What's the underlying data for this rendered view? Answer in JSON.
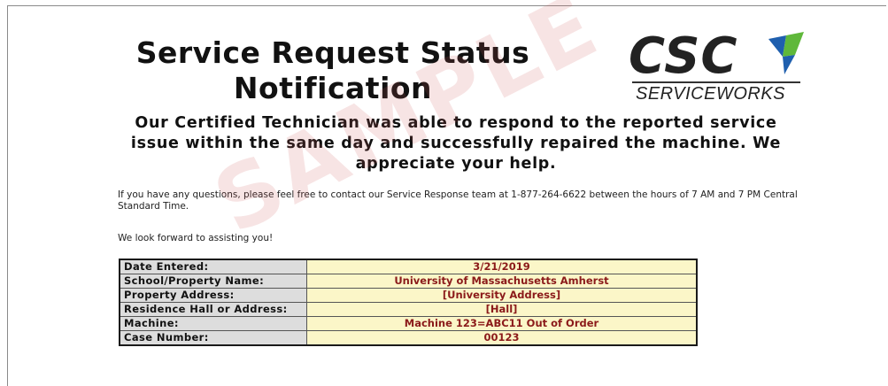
{
  "document": {
    "title_line1": "Service Request Status",
    "title_line2": "Notification",
    "intro": "Our Certified Technician was able to respond to the reported service issue within the same day and successfully repaired the machine. We appreciate your help.",
    "contact": "If you have any questions, please feel free to contact our Service Response team at 1-877-264-6622 between the hours of 7 AM and 7 PM Central Standard Time.",
    "thanks": "We look forward to assisting you!",
    "watermark": "SAMPLE"
  },
  "logo": {
    "brand": "CSC",
    "tagline": "SERVICEWORKS",
    "colors": {
      "blue": "#1f5fae",
      "green": "#5fb83a",
      "dark": "#222222"
    }
  },
  "info_table": {
    "rows": [
      {
        "label": "Date Entered:",
        "value": "3/21/2019"
      },
      {
        "label": "School/Property Name:",
        "value": "University of Massachusetts Amherst"
      },
      {
        "label": "Property Address:",
        "value": "[University Address]"
      },
      {
        "label": "Residence Hall or Address:",
        "value": "[Hall]"
      },
      {
        "label": "Machine:",
        "value": "Machine 123=ABC11 Out of Order"
      },
      {
        "label": "Case Number:",
        "value": "00123"
      }
    ]
  },
  "colors": {
    "label_bg": "#dddddd",
    "value_bg": "#fbf6c8",
    "value_text": "#8b1a1a",
    "watermark": "#cd5a5a"
  }
}
